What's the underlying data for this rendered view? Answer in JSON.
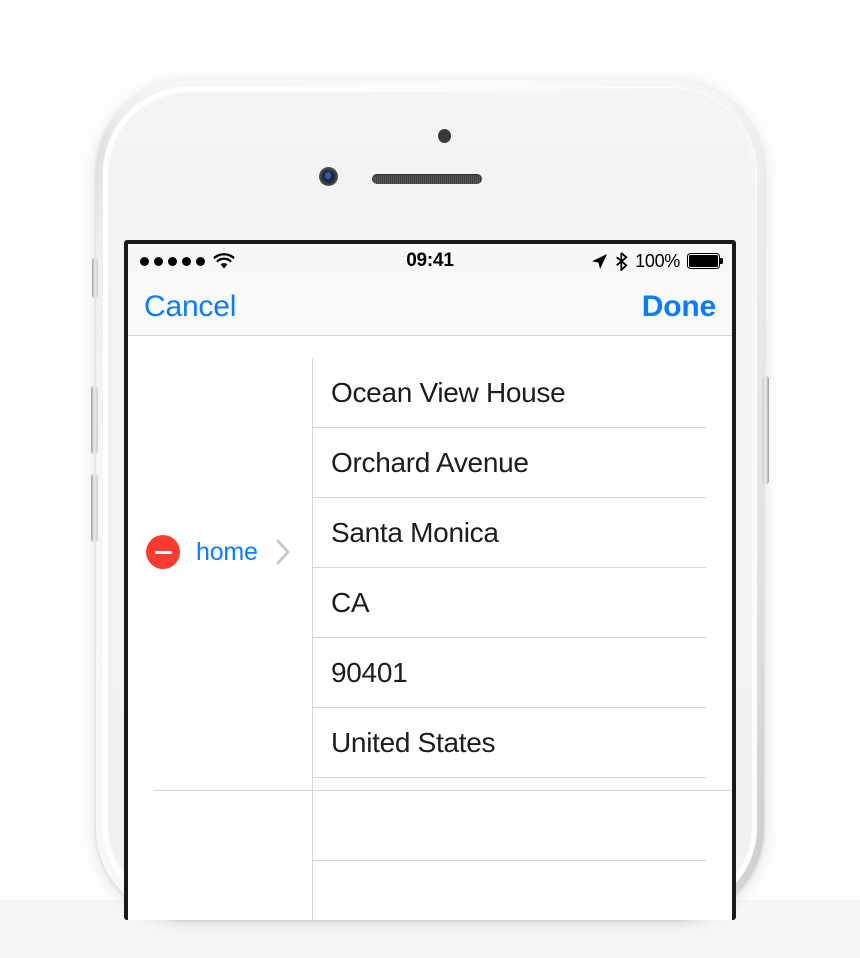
{
  "device": {
    "model_chrome": "iphone-white-silver",
    "hardware": {
      "sensor": "proximity-sensor",
      "camera": "front-camera",
      "speaker": "earpiece-speaker",
      "mute_switch": "mute-switch",
      "volume_up": "volume-up-button",
      "volume_down": "volume-down-button",
      "power": "power-button"
    }
  },
  "status_bar": {
    "signal_dots": 5,
    "wifi_icon": "wifi-icon",
    "time": "09:41",
    "location_icon": "location-arrow-icon",
    "bluetooth_icon": "bluetooth-icon",
    "battery_percent": "100%",
    "battery_level": 100
  },
  "nav_bar": {
    "cancel_label": "Cancel",
    "done_label": "Done",
    "accent_color": "#0a7cff"
  },
  "address_entry": {
    "delete_icon": "remove-circle-icon",
    "delete_color": "#fb3b30",
    "label": "home",
    "label_color": "#0a7cff",
    "disclosure_icon": "chevron-right-icon",
    "fields": [
      {
        "name": "street-line-1",
        "value": "Ocean View House"
      },
      {
        "name": "street-line-2",
        "value": "Orchard Avenue"
      },
      {
        "name": "city",
        "value": "Santa Monica"
      },
      {
        "name": "state",
        "value": "CA"
      },
      {
        "name": "postal-code",
        "value": "90401"
      },
      {
        "name": "country",
        "value": "United States"
      }
    ],
    "empty_fields": [
      {
        "name": "empty-field-1",
        "value": ""
      },
      {
        "name": "empty-field-2",
        "value": ""
      }
    ]
  }
}
